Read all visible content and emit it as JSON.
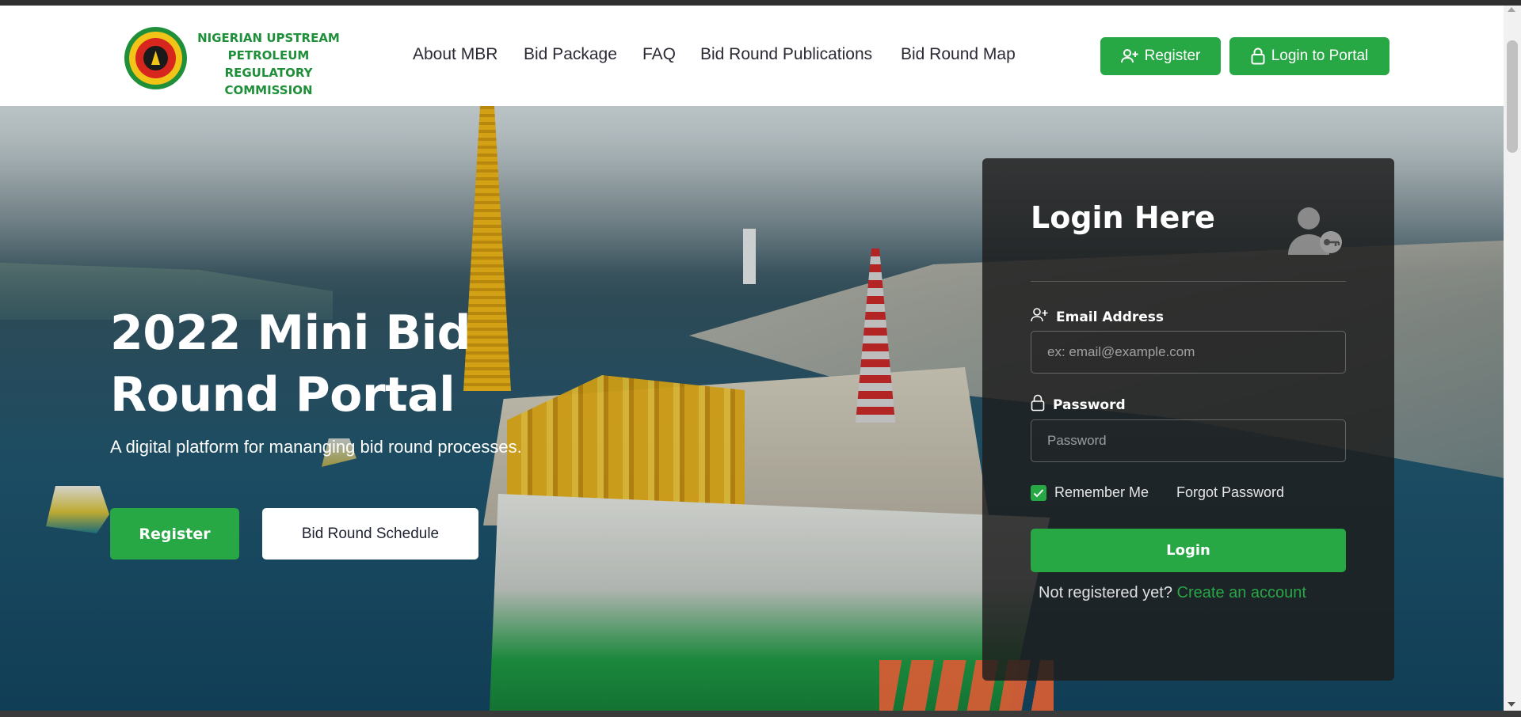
{
  "brand": {
    "name_lines": [
      "NIGERIAN UPSTREAM",
      "PETROLEUM REGULATORY",
      "COMMISSION"
    ],
    "logo_icon": "nuprc-seal-logo",
    "color_green": "#1f8f3a"
  },
  "nav": {
    "items": [
      {
        "label": "About MBR"
      },
      {
        "label": "Bid Package"
      },
      {
        "label": "FAQ"
      },
      {
        "label": "Bid Round Publications"
      },
      {
        "label": "Bid Round Map"
      }
    ]
  },
  "header_buttons": {
    "register": {
      "label": "Register",
      "icon": "user-plus-icon"
    },
    "login_portal": {
      "label": "Login to Portal",
      "icon": "lock-icon"
    }
  },
  "hero": {
    "title": "2022 Mini Bid Round Portal",
    "subtitle": "A digital platform for mananging bid round processes.",
    "register_label": "Register",
    "schedule_label": "Bid Round Schedule"
  },
  "login": {
    "title": "Login Here",
    "illustration_icon": "user-key-icon",
    "email_label": "Email Address",
    "email_icon": "user-plus-icon",
    "email_placeholder": "ex: email@example.com",
    "password_label": "Password",
    "password_icon": "lock-icon",
    "password_placeholder": "Password",
    "remember_label": "Remember Me",
    "remember_checked": true,
    "forgot_label": "Forgot Password",
    "button_label": "Login",
    "signup_prompt": "Not registered yet?",
    "signup_link": "Create an account"
  },
  "colors": {
    "accent": "#28a745",
    "card_bg": "rgba(30,30,30,0.84)",
    "nav_text": "#2a2a35"
  }
}
